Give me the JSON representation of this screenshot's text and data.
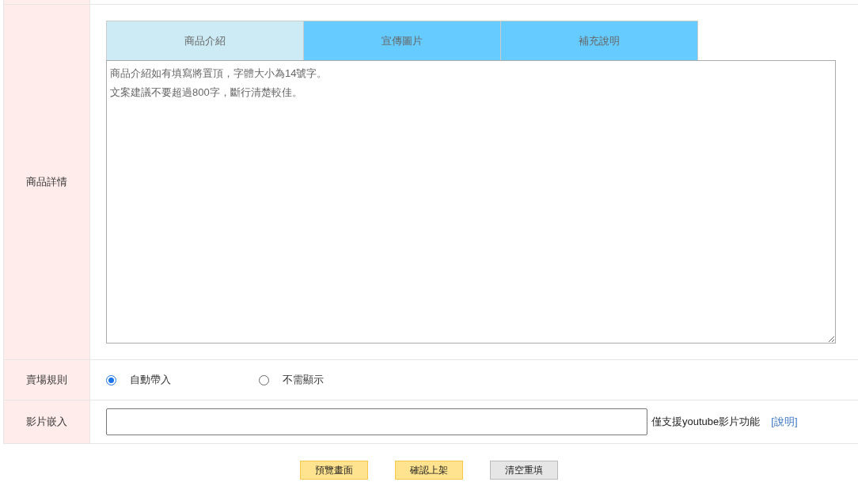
{
  "detail_row": {
    "label": "商品詳情",
    "tabs": [
      {
        "label": "商品介紹",
        "selected": true
      },
      {
        "label": "宣傳圖片",
        "selected": false
      },
      {
        "label": "補充說明",
        "selected": false
      }
    ],
    "editor": {
      "hint_lines": [
        "商品介紹如有填寫將置頂，字體大小為14號字。",
        "文案建議不要超過800字，斷行清楚較佳。"
      ]
    }
  },
  "rules_row": {
    "label": "賣場規則",
    "options": [
      {
        "label": "自動帶入",
        "selected": true
      },
      {
        "label": "不需顯示",
        "selected": false
      }
    ]
  },
  "video_row": {
    "label": "影片嵌入",
    "note": "僅支援youtube影片功能",
    "help_link": "[說明]"
  },
  "buttons": [
    {
      "label": "預覽畫面",
      "kind": "primary"
    },
    {
      "label": "確認上架",
      "kind": "primary"
    },
    {
      "label": "清空重填",
      "kind": "secondary"
    }
  ]
}
